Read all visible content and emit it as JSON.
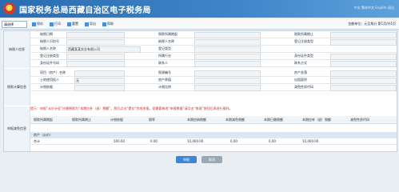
{
  "header": {
    "title": "国家税务总局西藏自治区电子税务局",
    "tools": "中文  繁体中文  English  退出"
  },
  "toolbar": {
    "select_value": "请选择",
    "buttons": [
      "保存",
      "打印",
      "重置",
      "导出",
      "帮助"
    ],
    "right_text": "金额单位：元至角分   第1页/共1页"
  },
  "form": {
    "section_taxpayer": "纳税人信息",
    "section_calc": "税款计算信息",
    "section_deduct": "申报减免信息",
    "row1": {
      "l1": "纳税日期",
      "l2": "税款所属期起",
      "l3": "税款所属期止"
    },
    "row2": {
      "l1": "纳税人识别号",
      "l2": "纳税人名称",
      "l3": "登记注册类型"
    },
    "row3": {
      "l1": "纳税人名称",
      "v1": "西藏某某实业有限公司",
      "l2": "登记类型",
      "v2": ""
    },
    "row4": {
      "l1": "登记注册类型",
      "l2": "所属行业",
      "l3": "身份证件类型"
    },
    "row5": {
      "l1": "身份证件号码",
      "l2": "联系人",
      "l3": "联系方式"
    },
    "row6": {
      "l1": "项目（房产）名称",
      "l2": "税源编号",
      "l3": "房产坐落"
    },
    "row7": {
      "l1": "土地使用权人",
      "v1": "无",
      "l2": "房产原值",
      "l3": "出租面积"
    },
    "row8": {
      "l1": "计税依据",
      "l2": "计税比例",
      "l3": "减免性质代码"
    },
    "notice": "提示：申报“从价计征”应缴税款为“本期应补（退）税额”，然后点击“提交”完成申报，如需要修改“申报数据”请点击“修改”按钮后再进行操作。",
    "grid_headers": [
      "税款所属期起",
      "税款所属期止",
      "计税依据",
      "税率",
      "本期应纳税额",
      "本期减免税额",
      "本期已缴税额",
      "本期应补（退）税额",
      "减免性质代码"
    ],
    "grid_rows": [
      [
        "房产（从价）",
        "",
        "",
        "",
        "",
        "",
        "",
        "",
        ""
      ],
      [
        "合计",
        "",
        "500.00",
        "0.00",
        "10,000.00",
        "0.00",
        "0.00",
        "10,000.00",
        ""
      ]
    ]
  },
  "footer": {
    "btn_submit": "申报",
    "btn_cancel": "取消"
  }
}
